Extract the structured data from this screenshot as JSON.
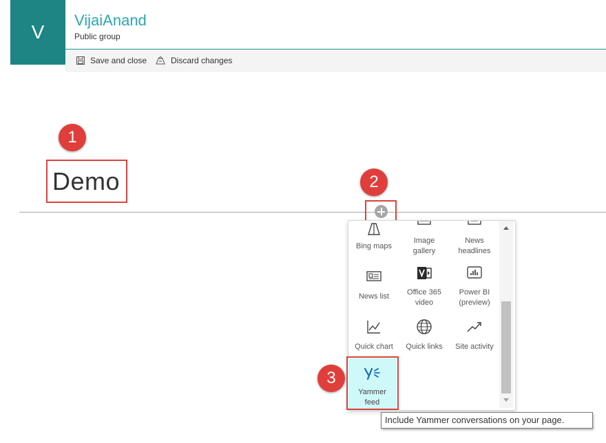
{
  "site": {
    "logo_letter": "V",
    "title": "VijaiAnand",
    "subtitle": "Public group",
    "brand_color": "#1e8484",
    "title_color": "#2aa6b4"
  },
  "command_bar": {
    "save_label": "Save and close",
    "save_icon": "floppy-disk-icon",
    "discard_label": "Discard changes",
    "discard_icon": "discard-icon"
  },
  "page": {
    "title": "Demo"
  },
  "annotations": {
    "badge_1": "1",
    "badge_2": "2",
    "badge_3": "3",
    "accent_color": "#e03e3a"
  },
  "webpart_picker": {
    "add_button_icon": "plus-circle-icon",
    "tiles": [
      {
        "label": "Bing maps",
        "icon": "map-icon"
      },
      {
        "label": "Image gallery",
        "icon": "image-gallery-icon"
      },
      {
        "label": "News headlines",
        "icon": "news-icon"
      },
      {
        "label": "News list",
        "icon": "news-list-icon"
      },
      {
        "label": "Office 365 video",
        "icon": "office-video-icon"
      },
      {
        "label": "Power BI (preview)",
        "icon": "power-bi-icon"
      },
      {
        "label": "Quick chart",
        "icon": "chart-icon"
      },
      {
        "label": "Quick links",
        "icon": "globe-icon"
      },
      {
        "label": "Site activity",
        "icon": "activity-icon"
      },
      {
        "label": "Yammer feed",
        "icon": "yammer-icon",
        "selected": true
      }
    ]
  },
  "tooltip": {
    "text": "Include Yammer conversations on your page."
  }
}
